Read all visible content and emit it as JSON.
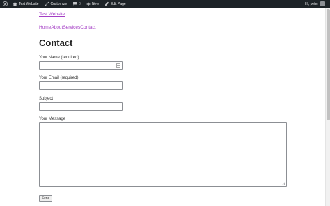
{
  "admin_bar": {
    "site_name": "Test Website",
    "customize": "Customize",
    "comments_count": "0",
    "new": "New",
    "edit_page": "Edit Page",
    "greeting": "Hi, peter"
  },
  "site": {
    "title": "Test Website",
    "nav": [
      "Home",
      "About",
      "Services",
      "Contact"
    ]
  },
  "page": {
    "title": "Contact"
  },
  "form": {
    "name_label": "Your Name (required)",
    "email_label": "Your Email (required)",
    "subject_label": "Subject",
    "message_label": "Your Message",
    "send_label": "Send"
  }
}
